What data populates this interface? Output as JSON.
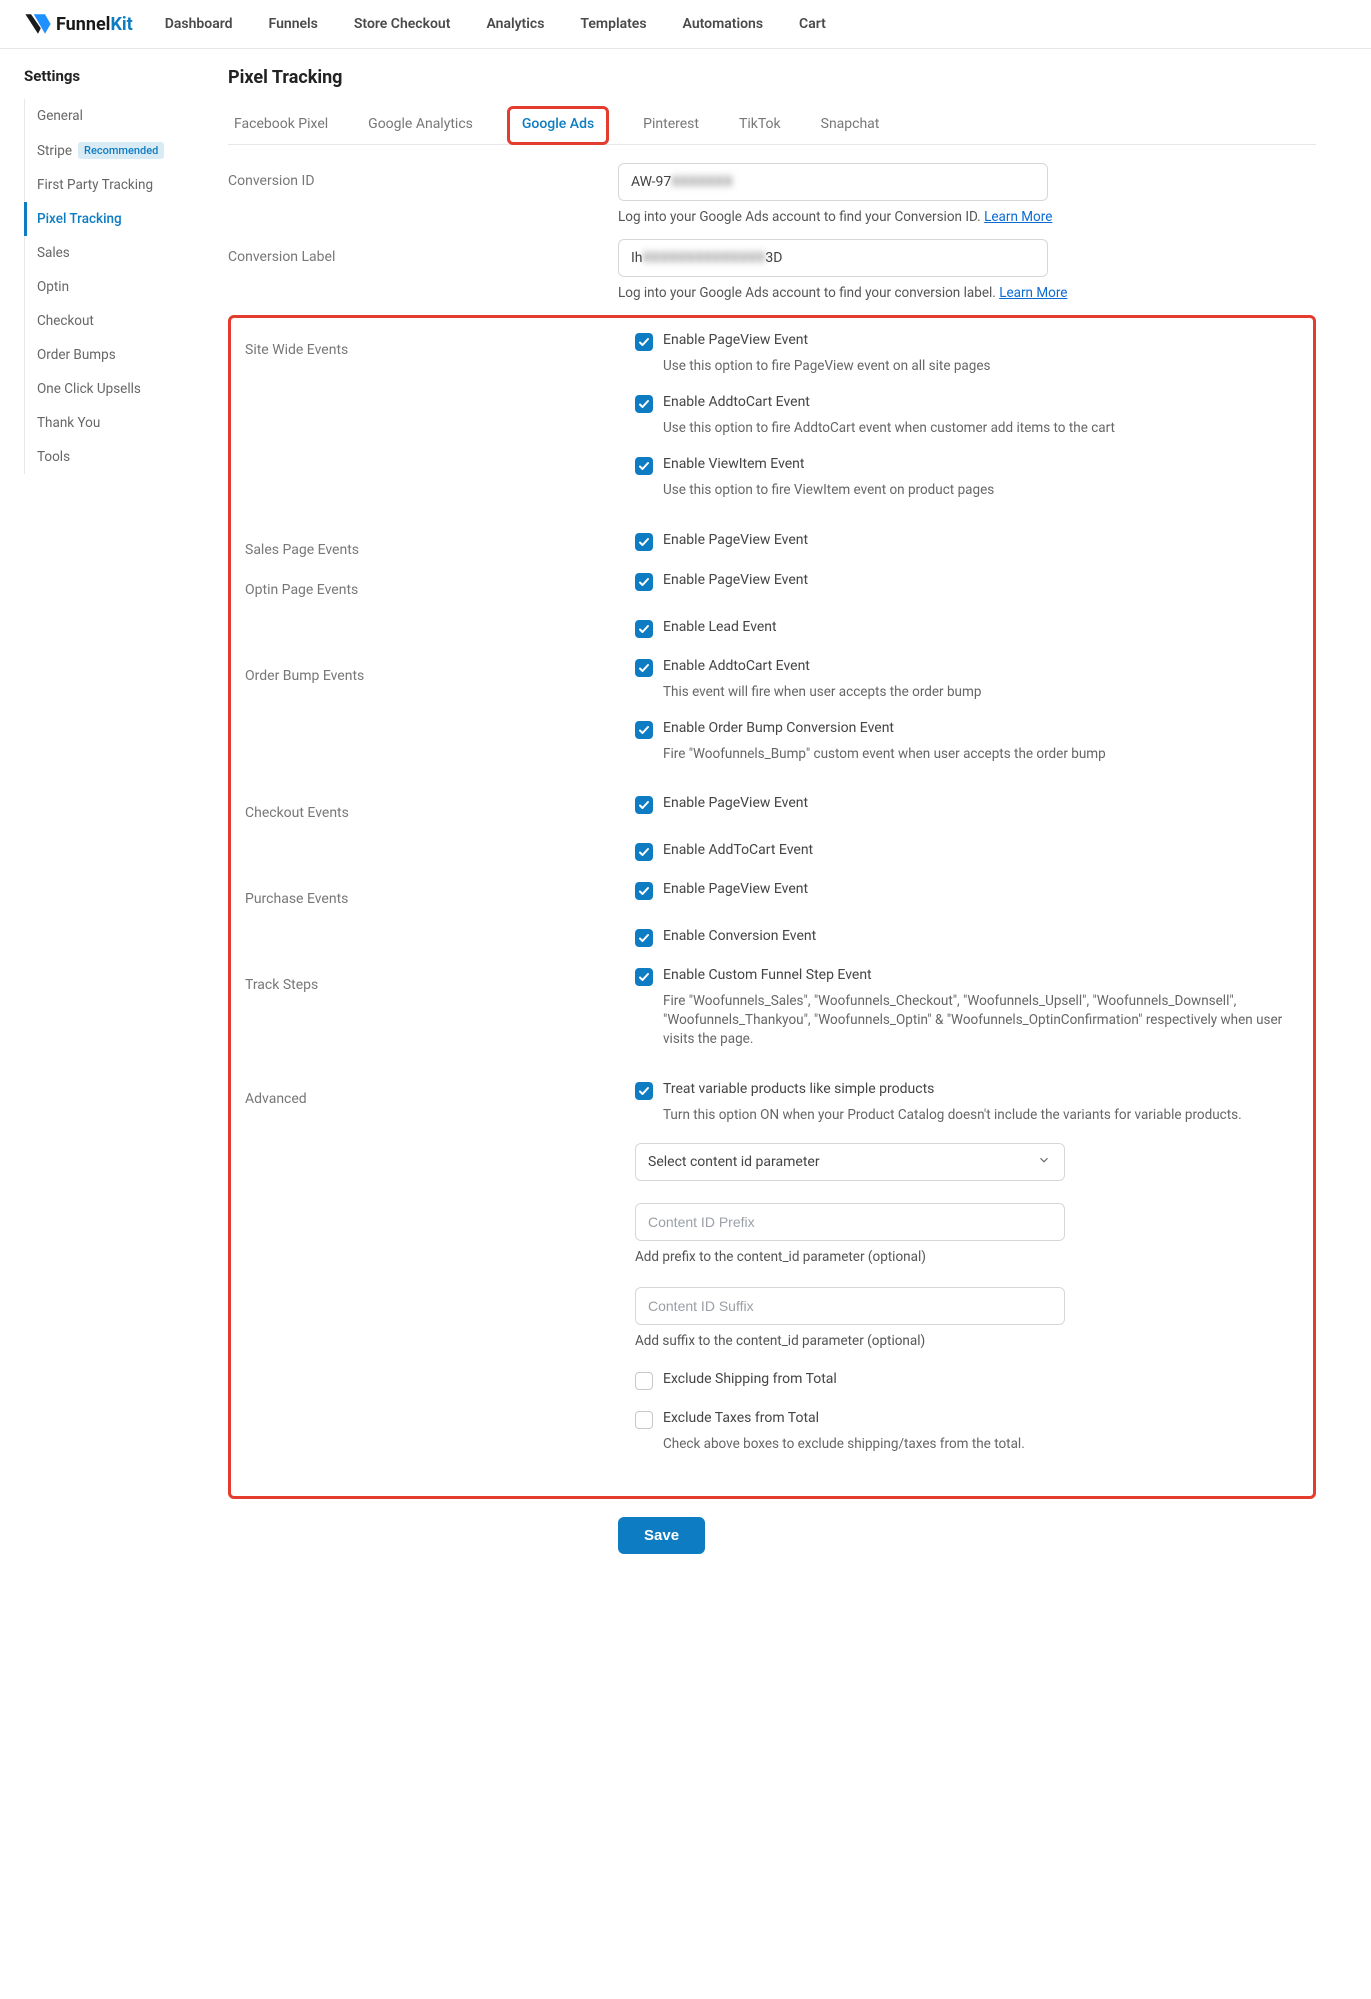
{
  "brand": {
    "name1": "Funnel",
    "name2": "Kit"
  },
  "topnav": [
    "Dashboard",
    "Funnels",
    "Store Checkout",
    "Analytics",
    "Templates",
    "Automations",
    "Cart"
  ],
  "sidebar": {
    "title": "Settings",
    "items": [
      {
        "label": "General"
      },
      {
        "label": "Stripe",
        "badge": "Recommended"
      },
      {
        "label": "First Party Tracking"
      },
      {
        "label": "Pixel Tracking",
        "active": true
      },
      {
        "label": "Sales"
      },
      {
        "label": "Optin"
      },
      {
        "label": "Checkout"
      },
      {
        "label": "Order Bumps"
      },
      {
        "label": "One Click Upsells"
      },
      {
        "label": "Thank You"
      },
      {
        "label": "Tools"
      }
    ]
  },
  "page_title": "Pixel Tracking",
  "tabs": [
    "Facebook Pixel",
    "Google Analytics",
    "Google Ads",
    "Pinterest",
    "TikTok",
    "Snapchat"
  ],
  "active_tab": "Google Ads",
  "conversion_id": {
    "label": "Conversion ID",
    "value_visible": "AW-97",
    "value_blurred": "XXXXXXX",
    "help": "Log into your Google Ads account to find your Conversion ID.",
    "learn": "Learn More"
  },
  "conversion_label": {
    "label": "Conversion Label",
    "value_visible_left": "Ih",
    "value_blurred": "XXXXXXXXXXXXXX",
    "value_visible_right": "3D",
    "help": "Log into your Google Ads account to find your conversion label.",
    "learn": "Learn More"
  },
  "sections": {
    "site_wide": {
      "label": "Site Wide Events",
      "items": [
        {
          "title": "Enable PageView Event",
          "desc": "Use this option to fire PageView event on all site pages",
          "checked": true
        },
        {
          "title": "Enable AddtoCart Event",
          "desc": "Use this option to fire AddtoCart event when customer add items to the cart",
          "checked": true
        },
        {
          "title": "Enable ViewItem Event",
          "desc": "Use this option to fire ViewItem event on product pages",
          "checked": true
        }
      ]
    },
    "sales_page": {
      "label": "Sales Page Events",
      "items": [
        {
          "title": "Enable PageView Event",
          "checked": true
        }
      ]
    },
    "optin_page": {
      "label": "Optin Page Events",
      "items": [
        {
          "title": "Enable PageView Event",
          "checked": true
        },
        {
          "title": "Enable Lead Event",
          "checked": true
        }
      ]
    },
    "order_bump": {
      "label": "Order Bump Events",
      "items": [
        {
          "title": "Enable AddtoCart Event",
          "desc": "This event will fire when user accepts the order bump",
          "checked": true
        },
        {
          "title": "Enable Order Bump Conversion Event",
          "desc": "Fire \"Woofunnels_Bump\" custom event when user accepts the order bump",
          "checked": true
        }
      ]
    },
    "checkout": {
      "label": "Checkout Events",
      "items": [
        {
          "title": "Enable PageView Event",
          "checked": true
        },
        {
          "title": "Enable AddToCart Event",
          "checked": true
        }
      ]
    },
    "purchase": {
      "label": "Purchase Events",
      "items": [
        {
          "title": "Enable PageView Event",
          "checked": true
        },
        {
          "title": "Enable Conversion Event",
          "checked": true
        }
      ]
    },
    "track_steps": {
      "label": "Track Steps",
      "items": [
        {
          "title": "Enable Custom Funnel Step Event",
          "desc": "Fire \"Woofunnels_Sales\", \"Woofunnels_Checkout\", \"Woofunnels_Upsell\", \"Woofunnels_Downsell\", \"Woofunnels_Thankyou\", \"Woofunnels_Optin\" & \"Woofunnels_OptinConfirmation\" respectively when user visits the page.",
          "checked": true
        }
      ]
    },
    "advanced": {
      "label": "Advanced",
      "treat_variable": {
        "title": "Treat variable products like simple products",
        "desc": "Turn this option ON when your Product Catalog doesn't include the variants for variable products.",
        "checked": true
      },
      "select_placeholder": "Select content id parameter",
      "prefix_placeholder": "Content ID Prefix",
      "prefix_help": "Add prefix to the content_id parameter (optional)",
      "suffix_placeholder": "Content ID Suffix",
      "suffix_help": "Add suffix to the content_id parameter (optional)",
      "exclude_shipping": {
        "title": "Exclude Shipping from Total",
        "checked": false
      },
      "exclude_taxes": {
        "title": "Exclude Taxes from Total",
        "desc": "Check above boxes to exclude shipping/taxes from the total.",
        "checked": false
      }
    }
  },
  "save_label": "Save"
}
